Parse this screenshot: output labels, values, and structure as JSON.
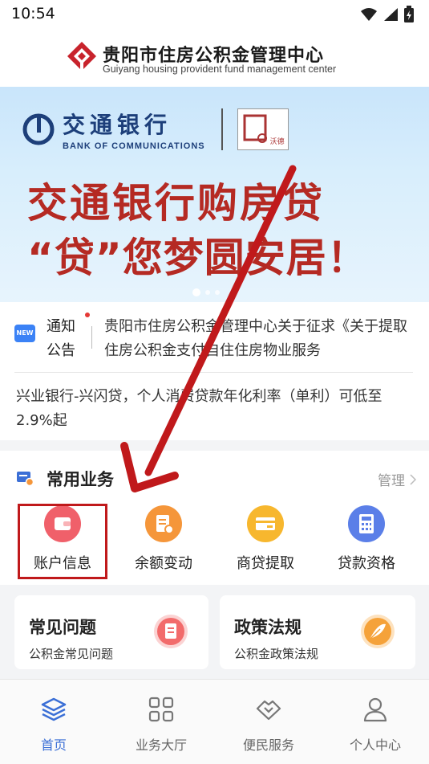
{
  "status_bar": {
    "time": "10:54"
  },
  "header": {
    "title": "贵阳市住房公积金管理中心",
    "subtitle": "Guiyang housing provident fund management center"
  },
  "banner": {
    "bank_name_cn": "交通银行",
    "bank_name_en": "BANK OF COMMUNICATIONS",
    "partner_text": "沃德",
    "headline_1": "交通银行购房贷",
    "headline_2": "“贷”您梦圆安居！"
  },
  "notice": {
    "icon_text": "NEW",
    "label": "通知公告",
    "text": "贵阳市住房公积金管理中心关于征求《关于提取住房公积金支付自住住房物业服务",
    "news": "兴业银行-兴闪贷，个人消费贷款年化利率（单利）可低至2.9%起"
  },
  "services": {
    "title": "常用业务",
    "manage_label": "管理",
    "items": [
      {
        "label": "账户信息",
        "color": "#f0606a",
        "icon": "wallet-icon"
      },
      {
        "label": "余额变动",
        "color": "#f5963a",
        "icon": "document-icon"
      },
      {
        "label": "商贷提取",
        "color": "#f7b72e",
        "icon": "card-icon"
      },
      {
        "label": "贷款资格",
        "color": "#5b7fe8",
        "icon": "calculator-icon"
      }
    ]
  },
  "cards": [
    {
      "title": "常见问题",
      "desc": "公积金常见问题",
      "color": "#f26b6b",
      "icon": "faq-icon"
    },
    {
      "title": "政策法规",
      "desc": "公积金政策法规",
      "color": "#f5a23a",
      "icon": "policy-icon"
    }
  ],
  "bottom_nav": [
    {
      "label": "首页",
      "icon": "home-layers-icon",
      "active": true
    },
    {
      "label": "业务大厅",
      "icon": "grid-icon",
      "active": false
    },
    {
      "label": "便民服务",
      "icon": "handshake-icon",
      "active": false
    },
    {
      "label": "个人中心",
      "icon": "person-icon",
      "active": false
    }
  ],
  "colors": {
    "accent_blue": "#3b6fd6",
    "banner_red": "#b52a23",
    "annotation_red": "#c0191b"
  }
}
